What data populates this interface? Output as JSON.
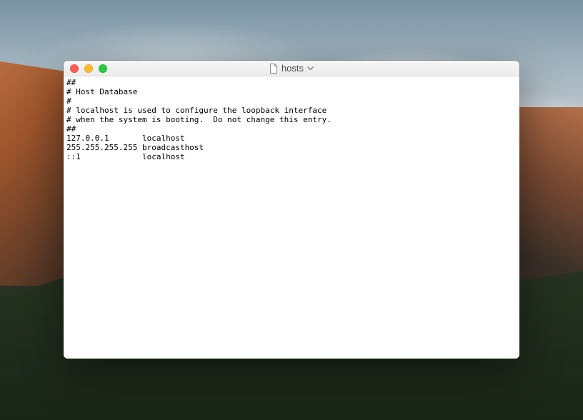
{
  "window": {
    "title": "hosts"
  },
  "editor": {
    "content": "##\n# Host Database\n#\n# localhost is used to configure the loopback interface\n# when the system is booting.  Do not change this entry.\n##\n127.0.0.1       localhost\n255.255.255.255 broadcasthost\n::1             localhost"
  }
}
